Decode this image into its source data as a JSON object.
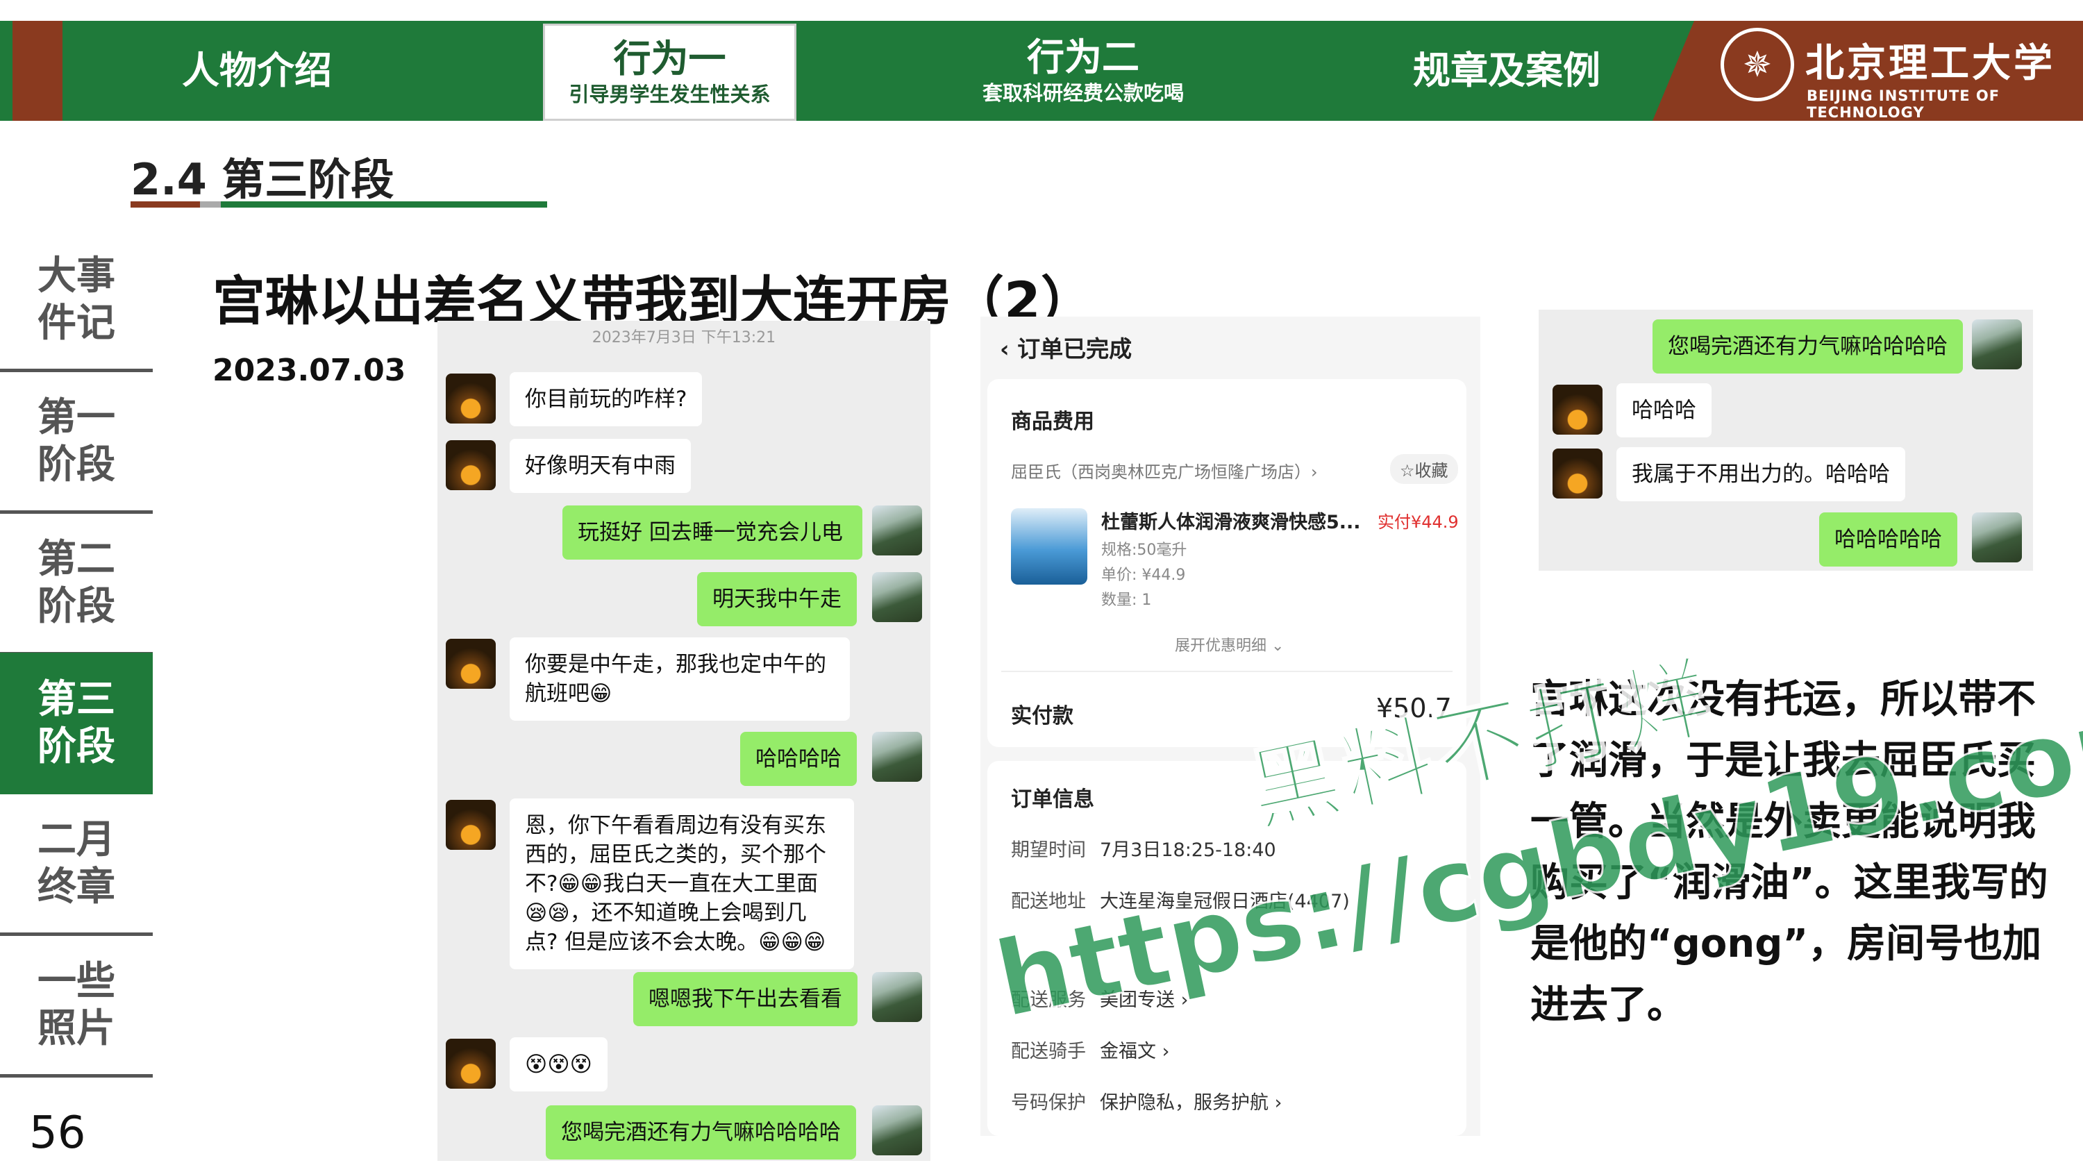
{
  "nav": {
    "tabs": [
      {
        "label": "人物介绍",
        "sub": ""
      },
      {
        "label": "行为一",
        "sub": "引导男学生发生性关系"
      },
      {
        "label": "行为二",
        "sub": "套取科研经费公款吃喝"
      },
      {
        "label": "规章及案例",
        "sub": ""
      }
    ]
  },
  "logo": {
    "cn": "北京理工大学",
    "en": "BEIJING INSTITUTE OF TECHNOLOGY"
  },
  "section_title": "2.4 第三阶段",
  "sidebar": {
    "items": [
      {
        "label": "大事件记"
      },
      {
        "label": "第一阶段"
      },
      {
        "label": "第二阶段"
      },
      {
        "label": "第三阶段"
      },
      {
        "label": "二月终章"
      },
      {
        "label": "一些照片"
      }
    ],
    "active_index": 3
  },
  "page_number": "56",
  "headline": "宫琳以出差名义带我到大连开房（2）",
  "date": "2023.07.03",
  "chat_left": {
    "timestamp": "2023年7月3日 下午13:21",
    "messages": [
      {
        "side": "left",
        "text": "你目前玩的咋样?"
      },
      {
        "side": "left",
        "text": "好像明天有中雨"
      },
      {
        "side": "right",
        "text": "玩挺好 回去睡一觉充会儿电"
      },
      {
        "side": "right",
        "text": "明天我中午走"
      },
      {
        "side": "left",
        "text": "你要是中午走，那我也定中午的航班吧😁"
      },
      {
        "side": "right",
        "text": "哈哈哈哈"
      },
      {
        "side": "left",
        "text": "恩，你下午看看周边有没有买东西的，屈臣氏之类的，买个那个不?😁😁我白天一直在大工里面😪😪，还不知道晚上会喝到几点? 但是应该不会太晚。😁😁😁"
      },
      {
        "side": "right",
        "text": "嗯嗯我下午出去看看"
      },
      {
        "side": "left",
        "text": "😵😵😵"
      },
      {
        "side": "right",
        "text": "您喝完酒还有力气嘛哈哈哈哈"
      }
    ]
  },
  "order": {
    "title": "订单已完成",
    "fee_header": "商品费用",
    "store": "屈臣氏（西岗奥林匹克广场恒隆广场店）›",
    "fav": "☆收藏",
    "product_name": "杜蕾斯人体润滑液爽滑快感5...",
    "paid_tag": "实付¥44.9",
    "spec": "规格:50毫升",
    "unit_price": "单价: ¥44.9",
    "qty": "数量: 1",
    "expand": "展开优惠明细 ⌄",
    "total_label": "实付款",
    "total_value": "¥50.7",
    "info_header": "订单信息",
    "rows": [
      {
        "k": "期望时间",
        "v": "7月3日18:25-18:40"
      },
      {
        "k": "配送地址",
        "v": "大连星海皇冠假日酒店(4407)"
      },
      {
        "k": "配送服务",
        "v": "美团专送 ›"
      },
      {
        "k": "配送骑手",
        "v": "金福文 ›"
      },
      {
        "k": "号码保护",
        "v": "保护隐私，服务护航 ›"
      }
    ]
  },
  "chat_right": {
    "messages": [
      {
        "side": "right",
        "text": "您喝完酒还有力气嘛哈哈哈哈"
      },
      {
        "side": "left",
        "text": "哈哈哈"
      },
      {
        "side": "left",
        "text": "我属于不用出力的。哈哈哈"
      },
      {
        "side": "right",
        "text": "哈哈哈哈哈"
      }
    ]
  },
  "right_text": "宫琳这次没有托运，所以带不了润滑，于是让我去屈臣氏买一管。当然是外卖更能说明我购买了“润滑油”。这里我写的是他的“gong”，房间号也加进去了。",
  "watermark": {
    "line1": "黑料不打烊",
    "line2": "https://cgbdy19.com"
  },
  "colors": {
    "green": "#1f7a3a",
    "brown": "#8a3a1f",
    "wechat_green": "#95ec69",
    "price_red": "#e0302f"
  }
}
